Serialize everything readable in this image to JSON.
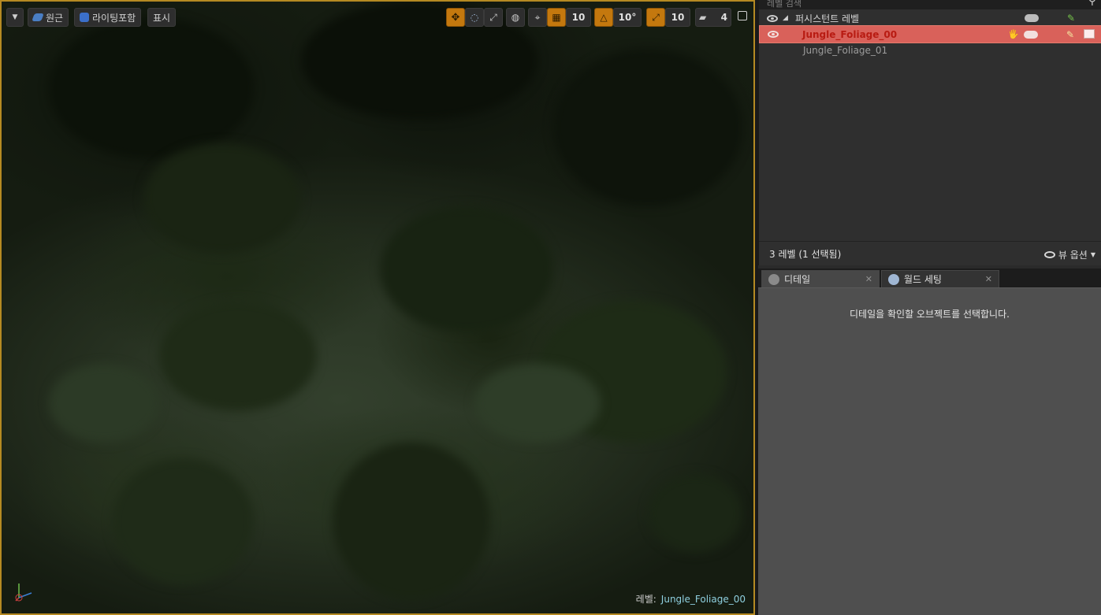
{
  "viewport": {
    "toolbar": {
      "menu_label": "▼",
      "perspective_label": "원근",
      "lighting_label": "라이팅포함",
      "show_label": "표시",
      "grid_snap_value": "10",
      "rotation_snap_value": "10°",
      "scale_snap_value": "10",
      "camera_speed_value": "4"
    },
    "level_readout": {
      "label": "레벨:",
      "value": "Jungle_Foliage_00"
    }
  },
  "levels": {
    "search_placeholder": "레벨 검색",
    "rows": [
      {
        "name": "퍼시스턴트 레벨"
      },
      {
        "name": "Jungle_Foliage_00"
      },
      {
        "name": "Jungle_Foliage_01"
      }
    ],
    "footer_count": "3 레벨 (1 선택됨)",
    "view_options_label": "뷰 옵션"
  },
  "tabs": [
    {
      "label": "디테일"
    },
    {
      "label": "월드 세팅"
    }
  ],
  "details": {
    "empty_message": "디테일을 확인할 오브젝트를 선택합니다."
  },
  "colors": {
    "selected_row": "#d9615a",
    "selected_text": "#b81b12",
    "viewport_border": "#b58a22",
    "snap_active": "#c4780e"
  }
}
